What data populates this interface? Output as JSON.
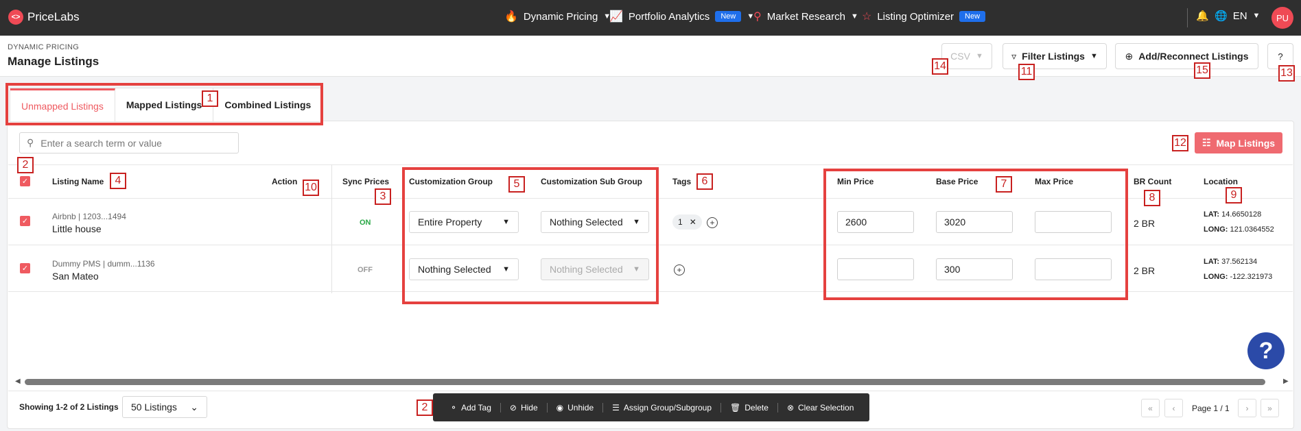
{
  "app": {
    "logo_text": "PriceLabs",
    "logo_glyph": "<>"
  },
  "nav": {
    "dynamic_pricing": "Dynamic Pricing",
    "portfolio_analytics": "Portfolio Analytics",
    "portfolio_badge": "New",
    "market_research": "Market Research",
    "listing_optimizer": "Listing Optimizer",
    "optimizer_badge": "New",
    "language": "EN",
    "avatar_initials": "PU"
  },
  "header": {
    "breadcrumb": "DYNAMIC PRICING",
    "title": "Manage Listings",
    "csv_label": "CSV",
    "filter_label": "Filter Listings",
    "add_label": "Add/Reconnect Listings",
    "help_label": "?"
  },
  "tabs": [
    {
      "label": "Unmapped Listings"
    },
    {
      "label": "Mapped Listings"
    },
    {
      "label": "Combined Listings"
    }
  ],
  "search": {
    "placeholder": "Enter a search term or value"
  },
  "map_button": {
    "label": "Map Listings"
  },
  "columns": {
    "listing_name": "Listing Name",
    "action": "Action",
    "sync_prices": "Sync Prices",
    "custom_group": "Customization Group",
    "custom_subgroup": "Customization Sub Group",
    "tags": "Tags",
    "min_price": "Min Price",
    "base_price": "Base Price",
    "max_price": "Max Price",
    "br_count": "BR Count",
    "location": "Location"
  },
  "rows": [
    {
      "source": "Airbnb | 1203...1494",
      "name": "Little house",
      "sync": "ON",
      "group": "Entire Property",
      "subgroup": "Nothing Selected",
      "tag": "1",
      "min_price": "2600",
      "base_price": "3020",
      "max_price": "",
      "br": "2 BR",
      "lat_label": "LAT:",
      "lat": "14.6650128",
      "long_label": "LONG:",
      "long": "121.0364552"
    },
    {
      "source": "Dummy PMS | dumm...1136",
      "name": "San Mateo",
      "sync": "OFF",
      "group": "Nothing Selected",
      "subgroup": "Nothing Selected",
      "tag": "",
      "min_price": "",
      "base_price": "300",
      "max_price": "",
      "br": "2 BR",
      "lat_label": "LAT:",
      "lat": "37.562134",
      "long_label": "LONG:",
      "long": "-122.321973"
    }
  ],
  "footer": {
    "showing": "Showing 1-2 of 2 Listings",
    "per_page": "50 Listings",
    "page_info": "Page 1 / 1"
  },
  "bulk_actions": {
    "add_tag": "Add Tag",
    "hide": "Hide",
    "unhide": "Unhide",
    "assign": "Assign Group/Subgroup",
    "delete": "Delete",
    "clear": "Clear Selection"
  },
  "annotations": [
    "1",
    "2",
    "2",
    "3",
    "4",
    "5",
    "6",
    "7",
    "8",
    "9",
    "10",
    "11",
    "12",
    "13",
    "14",
    "15"
  ],
  "colors": {
    "accent": "#ef5a60",
    "nav_bg": "#2f2f2f",
    "highlight": "#e5413f",
    "badge_blue": "#1f6feb",
    "on_green": "#28a745"
  }
}
